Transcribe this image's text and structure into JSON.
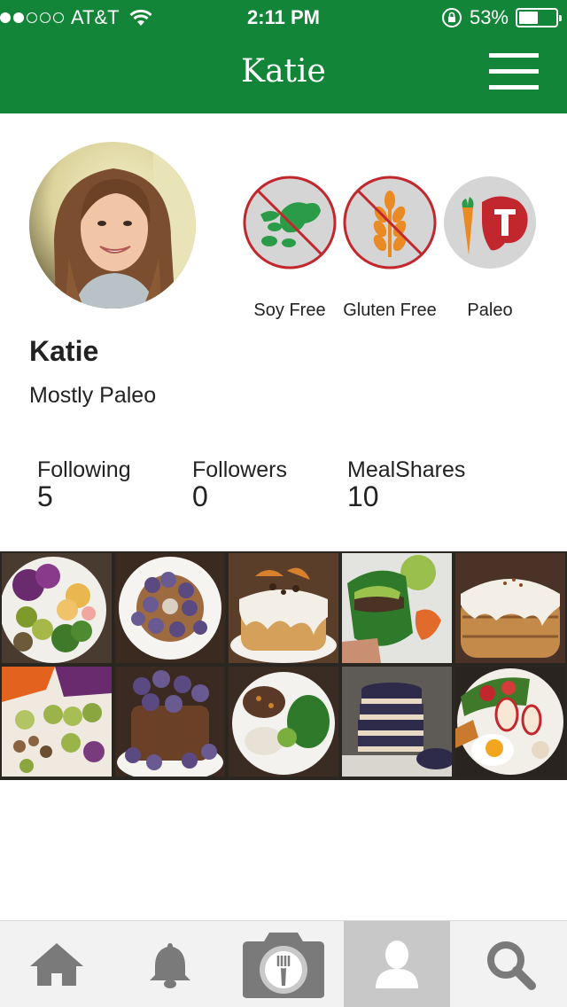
{
  "status_bar": {
    "carrier": "AT&T",
    "time": "2:11 PM",
    "battery": "53%",
    "battery_level": 0.53,
    "signal_bars_filled": 2,
    "signal_bars_total": 5
  },
  "nav": {
    "title": "Katie"
  },
  "profile": {
    "name": "Katie",
    "bio": "Mostly Paleo",
    "diets": [
      {
        "label": "Soy Free",
        "icon": "soy-free-icon"
      },
      {
        "label": "Gluten Free",
        "icon": "gluten-free-icon"
      },
      {
        "label": "Paleo",
        "icon": "paleo-icon"
      }
    ]
  },
  "stats": [
    {
      "label": "Following",
      "value": "5"
    },
    {
      "label": "Followers",
      "value": "0"
    },
    {
      "label": "MealShares",
      "value": "10"
    }
  ],
  "meal_photos": [
    {
      "name": "roasted-vegetables-plate"
    },
    {
      "name": "blueberry-pancake-plate"
    },
    {
      "name": "pancake-stack-with-icing"
    },
    {
      "name": "lettuce-wrap-burger"
    },
    {
      "name": "cinnamon-pancake-stack"
    },
    {
      "name": "roasted-vegetable-sheet"
    },
    {
      "name": "blueberry-cake"
    },
    {
      "name": "ground-beef-greens-plate"
    },
    {
      "name": "chocolate-cookie-stack"
    },
    {
      "name": "egg-salad-plate"
    }
  ],
  "tabs": [
    {
      "name": "home",
      "icon": "home-icon",
      "active": false
    },
    {
      "name": "notifications",
      "icon": "bell-icon",
      "active": false
    },
    {
      "name": "share-meal",
      "icon": "camera-fork-icon",
      "active": false
    },
    {
      "name": "profile",
      "icon": "person-icon",
      "active": true
    },
    {
      "name": "search",
      "icon": "search-icon",
      "active": false
    }
  ],
  "colors": {
    "brand_green": "#128539",
    "badge_red": "#c1272d",
    "tab_icon_gray": "#7a7a7a",
    "active_tab_bg": "#c8c8c8"
  }
}
